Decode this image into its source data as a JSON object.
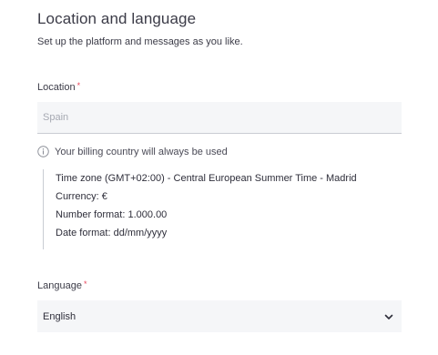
{
  "section": {
    "title": "Location and language",
    "subtitle": "Set up the platform and messages as you like."
  },
  "location": {
    "label": "Location",
    "required_mark": "*",
    "placeholder": "Spain",
    "value": ""
  },
  "info": {
    "icon": "info-circle-icon",
    "text": "Your billing country will always be used"
  },
  "details": {
    "timezone_label": "Time zone",
    "timezone_value": "(GMT+02:00) - Central European Summer Time - Madrid",
    "currency_label": "Currency:",
    "currency_value": "€",
    "number_label": "Number format:",
    "number_value": "1.000.00",
    "date_label": "Date format:",
    "date_value": "dd/mm/yyyy"
  },
  "language": {
    "label": "Language",
    "required_mark": "*",
    "selected": "English",
    "icon": "chevron-down-icon"
  },
  "colors": {
    "required": "#e8455b",
    "field_bg": "#f5f6f8",
    "text": "#2e2e3a"
  }
}
